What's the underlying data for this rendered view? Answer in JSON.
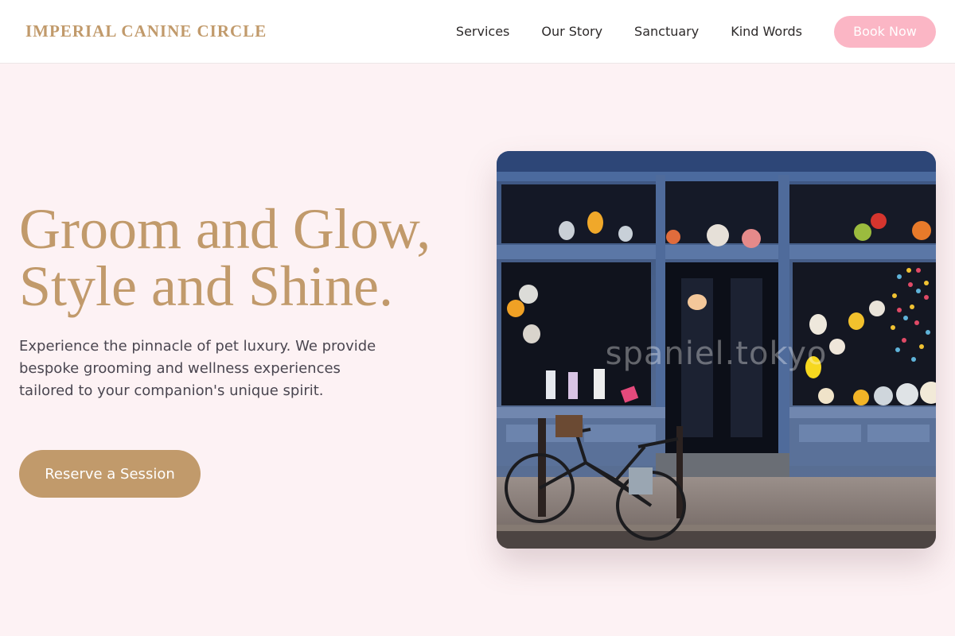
{
  "brand": {
    "name": "IMPERIAL CANINE CIRCLE"
  },
  "nav": {
    "items": [
      {
        "label": "Services"
      },
      {
        "label": "Our Story"
      },
      {
        "label": "Sanctuary"
      },
      {
        "label": "Kind Words"
      }
    ],
    "cta_label": "Book Now"
  },
  "hero": {
    "title_line1": "Groom and Glow,",
    "title_line2": "Style and Shine.",
    "description": "Experience the pinnacle of pet luxury. We provide bespoke grooming and wellness experiences tailored to your companion's unique spirit.",
    "cta_label": "Reserve a Session"
  },
  "photo": {
    "subject": "blue-storefront-with-bicycle",
    "watermark": "spaniel.tokyo"
  },
  "colors": {
    "accent": "#c19a6b",
    "pink": "#fbb6c5",
    "background": "#fdf2f4"
  }
}
